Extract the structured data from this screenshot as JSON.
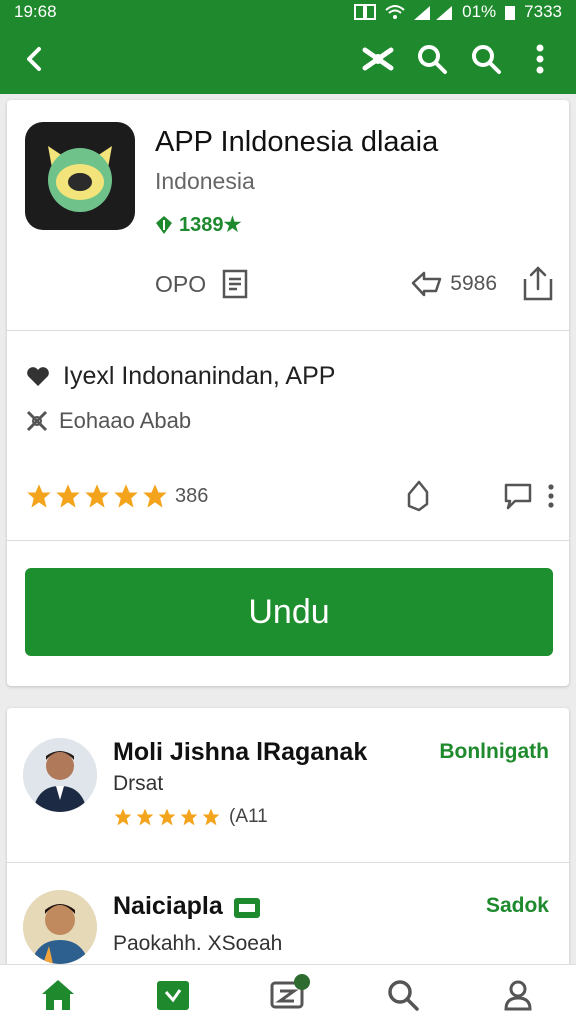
{
  "status_bar": {
    "time": "19:68",
    "icons_text": "01%",
    "battery_text": "7333"
  },
  "app_bar": {
    "back_icon": "back-arrow-icon",
    "actions": [
      "shuffle-icon",
      "search-icon",
      "search-icon",
      "more-vert-icon"
    ]
  },
  "app": {
    "title": "APP Inldonesia dlaaia",
    "subtitle": "Indonesia",
    "rating_text": "1389★",
    "developer_label": "OPO",
    "share_count": "5986",
    "info_line_1": "Iyexl Indonanindan, APP",
    "info_line_2": "Eohaao Abab",
    "stars": 5,
    "rating_count": "386",
    "download_label": "Undu"
  },
  "reviews": [
    {
      "name": "Moli Jishna lRaganak",
      "subtitle": "Drsat",
      "stars": 5,
      "count": "(A11",
      "action": "Bonlnigath"
    },
    {
      "name": "Naiciapla",
      "subtitle": "Paokahh. XSoeah",
      "action": "Sadok"
    }
  ],
  "bottom_nav": [
    "home-icon",
    "store-icon",
    "chat-icon",
    "search-icon",
    "profile-icon"
  ],
  "colors": {
    "primary": "#1e8a2d",
    "button": "#1e8f2e",
    "star": "#f4a41c"
  }
}
